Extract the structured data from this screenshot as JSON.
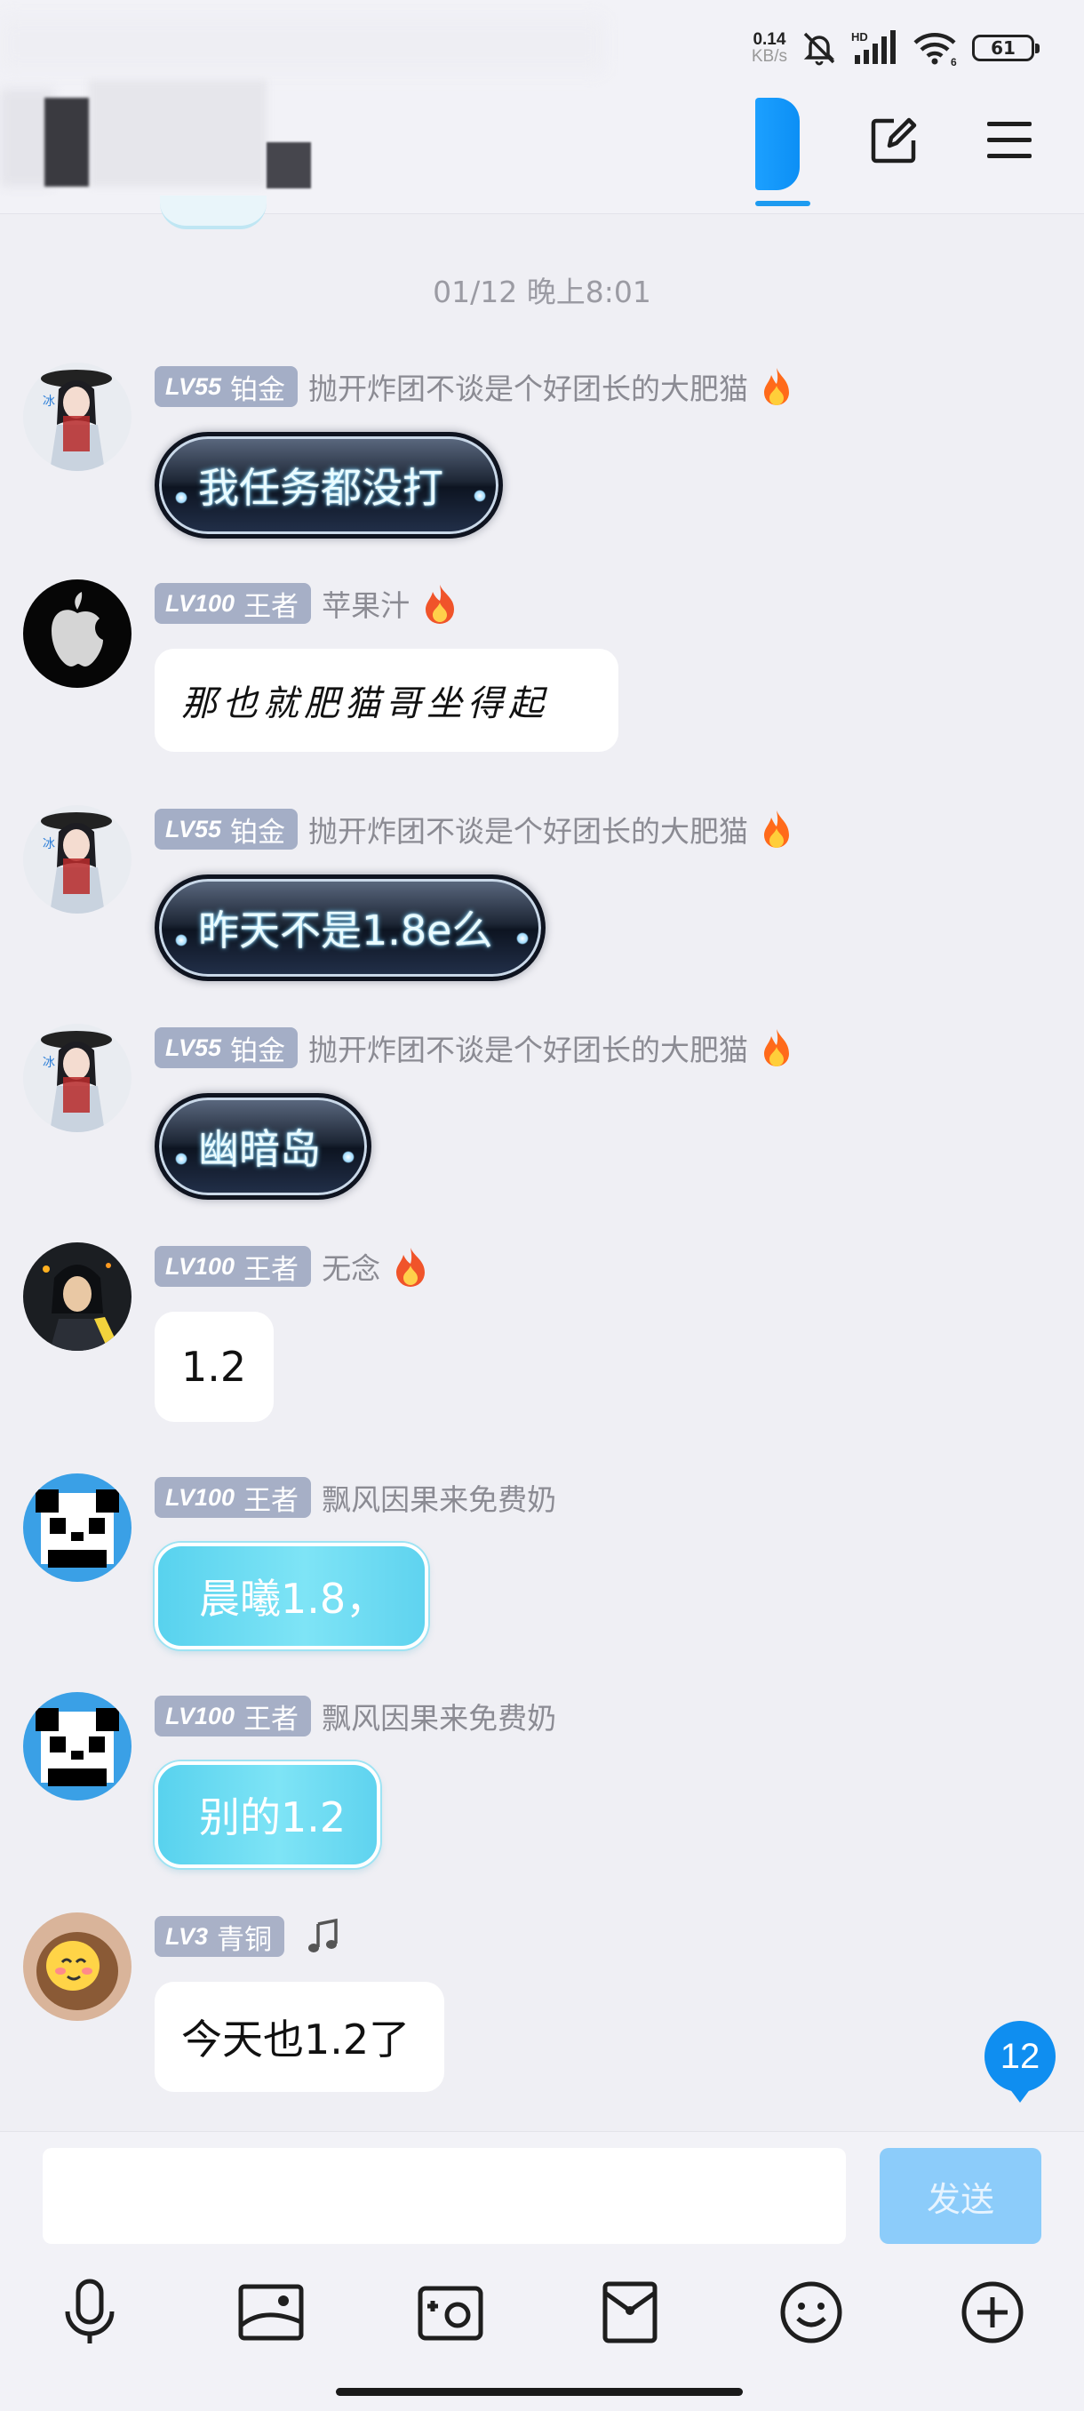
{
  "status_bar": {
    "net_speed": "0.14",
    "net_unit": "KB/s",
    "signal_label": "HD",
    "wifi_label": "6",
    "battery": "61"
  },
  "header": {
    "edit_icon": "edit-icon",
    "menu_icon": "menu-icon",
    "accent_color": "#1d9bf0"
  },
  "chat": {
    "time_divider": "01/12 晚上8:01",
    "messages": [
      {
        "level": "LV55",
        "rank": "铂金",
        "nickname": "抛开炸团不谈是个好团长的大肥猫",
        "nick_icon": "flame-icon",
        "text": "我任务都没打",
        "style": "dark-glow-bubble"
      },
      {
        "level": "LV100",
        "rank": "王者",
        "nickname": "苹果汁",
        "nick_icon": "flame-icon",
        "text": "那也就肥猫哥坐得起",
        "style": "handwriting"
      },
      {
        "level": "LV55",
        "rank": "铂金",
        "nickname": "抛开炸团不谈是个好团长的大肥猫",
        "nick_icon": "flame-icon",
        "text": "昨天不是1.8e么",
        "style": "dark-glow-bubble"
      },
      {
        "level": "LV55",
        "rank": "铂金",
        "nickname": "抛开炸团不谈是个好团长的大肥猫",
        "nick_icon": "flame-icon",
        "text": "幽暗岛",
        "style": "dark-glow-bubble"
      },
      {
        "level": "LV100",
        "rank": "王者",
        "nickname": "无念",
        "nick_icon": "flame-icon",
        "text": "1.2",
        "style": "plain"
      },
      {
        "level": "LV100",
        "rank": "王者",
        "nickname": "飘风因果来免费奶",
        "nick_icon": "",
        "text": "晨曦1.8，",
        "style": "cyan-bubble"
      },
      {
        "level": "LV100",
        "rank": "王者",
        "nickname": "飘风因果来免费奶",
        "nick_icon": "",
        "text": "别的1.2",
        "style": "cyan-bubble"
      },
      {
        "level": "LV3",
        "rank": "青铜",
        "nickname": "",
        "nick_icon": "music-note-icon",
        "text": "今天也1.2了",
        "style": "plain"
      }
    ],
    "unread_count": "12"
  },
  "input": {
    "placeholder": "",
    "send_label": "发送"
  },
  "toolbar": [
    "microphone-icon",
    "image-icon",
    "camera-icon",
    "red-packet-icon",
    "emoji-icon",
    "plus-icon"
  ]
}
